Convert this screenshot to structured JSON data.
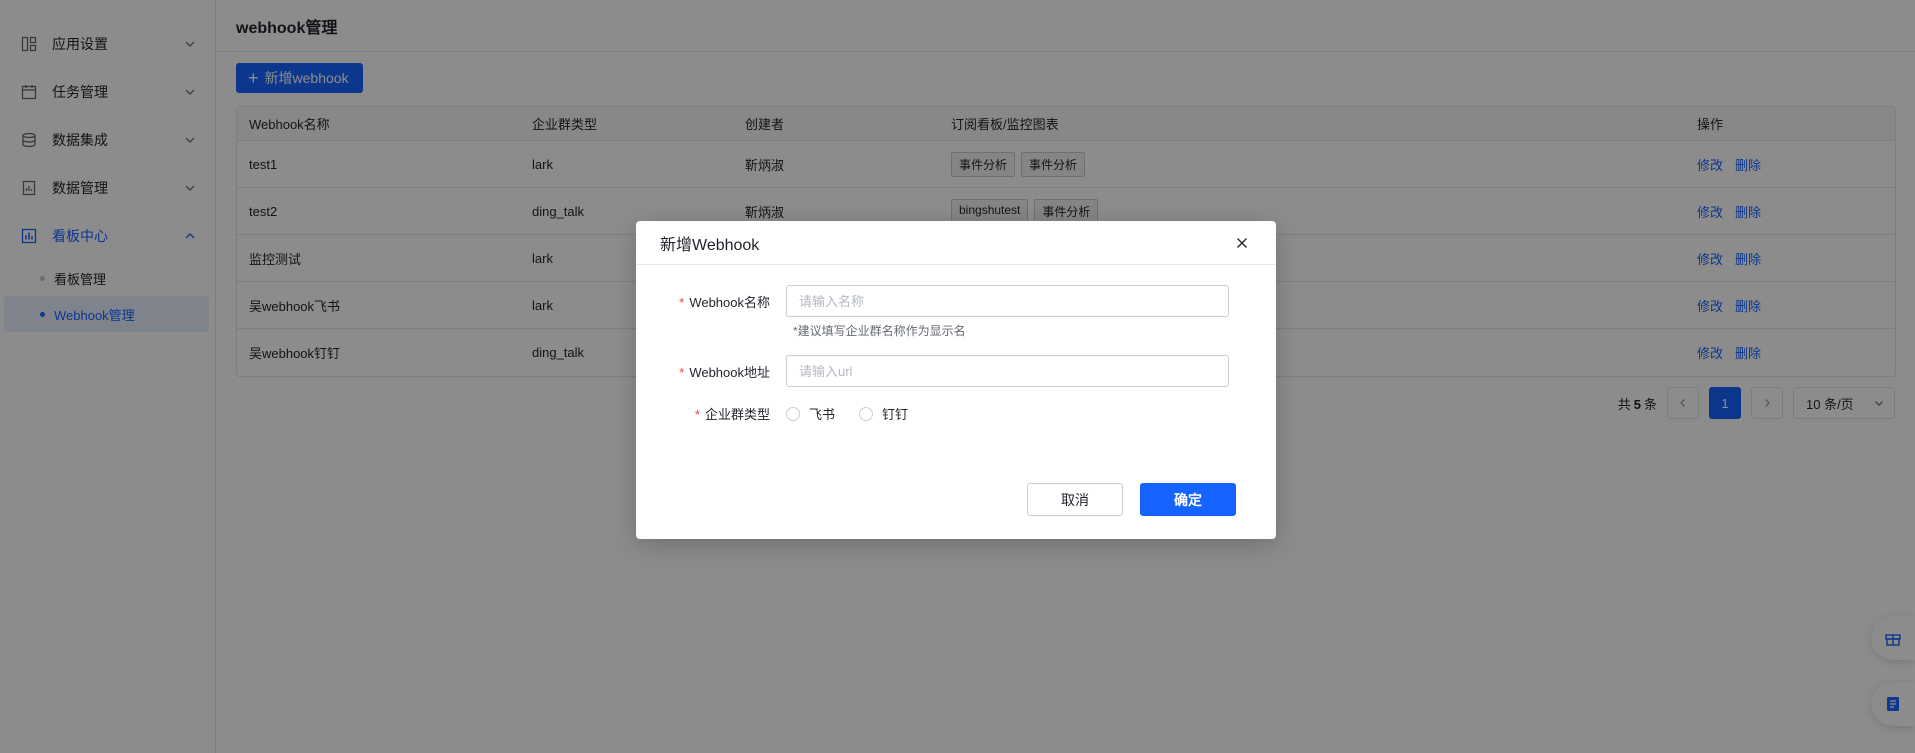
{
  "sidebar": {
    "groups": [
      {
        "label": "应用设置",
        "icon": "layout-icon"
      },
      {
        "label": "任务管理",
        "icon": "calendar-icon"
      },
      {
        "label": "数据集成",
        "icon": "database-icon"
      },
      {
        "label": "数据管理",
        "icon": "document-chart-icon"
      },
      {
        "label": "看板中心",
        "icon": "bar-chart-icon"
      }
    ],
    "sub_items": [
      {
        "label": "看板管理"
      },
      {
        "label": "Webhook管理"
      }
    ]
  },
  "page": {
    "title": "webhook管理",
    "add_button": "新增webhook"
  },
  "table": {
    "headers": [
      "Webhook名称",
      "企业群类型",
      "创建者",
      "订阅看板/监控图表",
      "操作"
    ],
    "rows": [
      {
        "name": "test1",
        "type": "lark",
        "creator": "靳炳淑",
        "tags": [
          "事件分析",
          "事件分析"
        ],
        "edit": "修改",
        "delete": "删除"
      },
      {
        "name": "test2",
        "type": "ding_talk",
        "creator": "靳炳淑",
        "tags": [
          "bingshutest",
          "事件分析"
        ],
        "edit": "修改",
        "delete": "删除"
      },
      {
        "name": "监控测试",
        "type": "lark",
        "creator": "",
        "tags": [],
        "edit": "修改",
        "delete": "删除"
      },
      {
        "name": "吴webhook飞书",
        "type": "lark",
        "creator": "",
        "tags": [],
        "edit": "修改",
        "delete": "删除"
      },
      {
        "name": "吴webhook钉钉",
        "type": "ding_talk",
        "creator": "",
        "tags": [],
        "edit": "修改",
        "delete": "删除"
      }
    ]
  },
  "pagination": {
    "total_prefix": "共",
    "total": "5",
    "total_suffix": "条",
    "current_page": "1",
    "page_size": "10 条/页"
  },
  "modal": {
    "title": "新增Webhook",
    "fields": {
      "name_label": "Webhook名称",
      "name_placeholder": "请输入名称",
      "name_hint": "*建议填写企业群名称作为显示名",
      "url_label": "Webhook地址",
      "url_placeholder": "请输入url",
      "type_label": "企业群类型",
      "type_options": [
        "飞书",
        "钉钉"
      ]
    },
    "cancel": "取消",
    "confirm": "确定"
  },
  "colors": {
    "accent": "#1664ff",
    "required": "#f53f3f",
    "mask": "rgba(0,0,0,0.45)"
  }
}
